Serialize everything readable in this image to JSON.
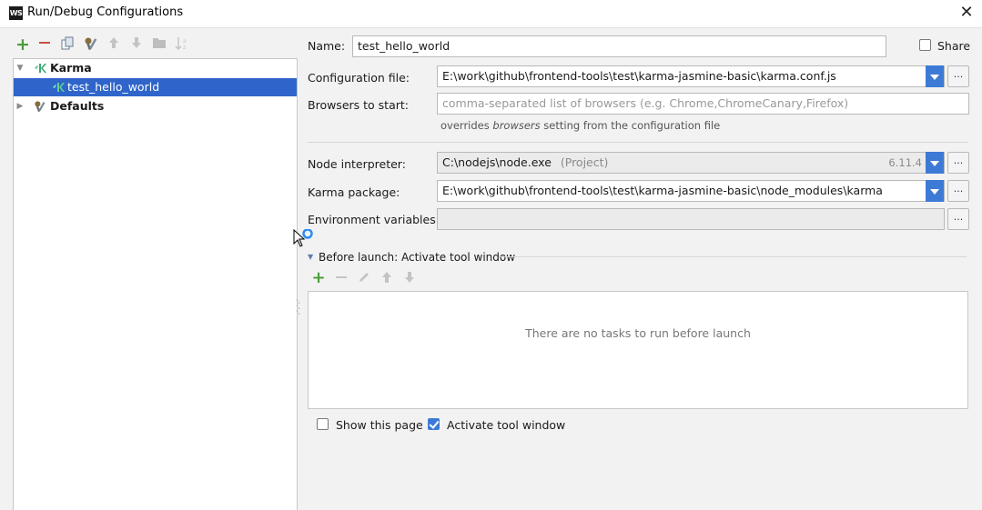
{
  "window": {
    "app_icon_text": "WS",
    "title": "Run/Debug Configurations",
    "close_glyph": "✕"
  },
  "left_toolbar": {
    "icons": [
      "add-icon",
      "remove-icon",
      "copy-icon",
      "edit-defaults-icon",
      "move-up-icon",
      "move-down-icon",
      "folder-icon",
      "sort-icon"
    ]
  },
  "tree": {
    "items": [
      {
        "label": "Karma",
        "expanded": true,
        "bold": true
      },
      {
        "label": "test_hello_world",
        "selected": true
      },
      {
        "label": "Defaults",
        "expanded": false,
        "bold": true
      }
    ]
  },
  "form": {
    "name_label": "Name:",
    "name_value": "test_hello_world",
    "share_label": "Share",
    "share_checked": false,
    "config_label": "Configuration file:",
    "config_value": "E:\\work\\github\\frontend-tools\\test\\karma-jasmine-basic\\karma.conf.js",
    "browsers_label": "Browsers to start:",
    "browsers_placeholder": "comma-separated list of browsers (e.g. Chrome,ChromeCanary,Firefox)",
    "browsers_hint_prefix": "overrides ",
    "browsers_hint_em": "browsers",
    "browsers_hint_suffix": " setting from the configuration file",
    "node_label": "Node interpreter:",
    "node_value": "C:\\nodejs\\node.exe",
    "node_tag": "(Project)",
    "node_version": "6.11.4",
    "karma_pkg_label": "Karma package:",
    "karma_pkg_value": "E:\\work\\github\\frontend-tools\\test\\karma-jasmine-basic\\node_modules\\karma",
    "env_label": "Environment variables:",
    "env_value": "",
    "dots": "..."
  },
  "before_launch": {
    "title": "Before launch: Activate tool window",
    "empty_text": "There are no tasks to run before launch",
    "tools": [
      "add-icon",
      "remove-icon",
      "edit-icon",
      "move-up-icon",
      "move-down-icon"
    ]
  },
  "options": {
    "show_page_label": "Show this page",
    "show_page_checked": false,
    "activate_label": "Activate tool window",
    "activate_checked": true
  },
  "colors": {
    "accent": "#3d7ad6",
    "selection": "#2f65ca",
    "add_green": "#4a9c3b",
    "remove_red": "#c94d3f"
  }
}
